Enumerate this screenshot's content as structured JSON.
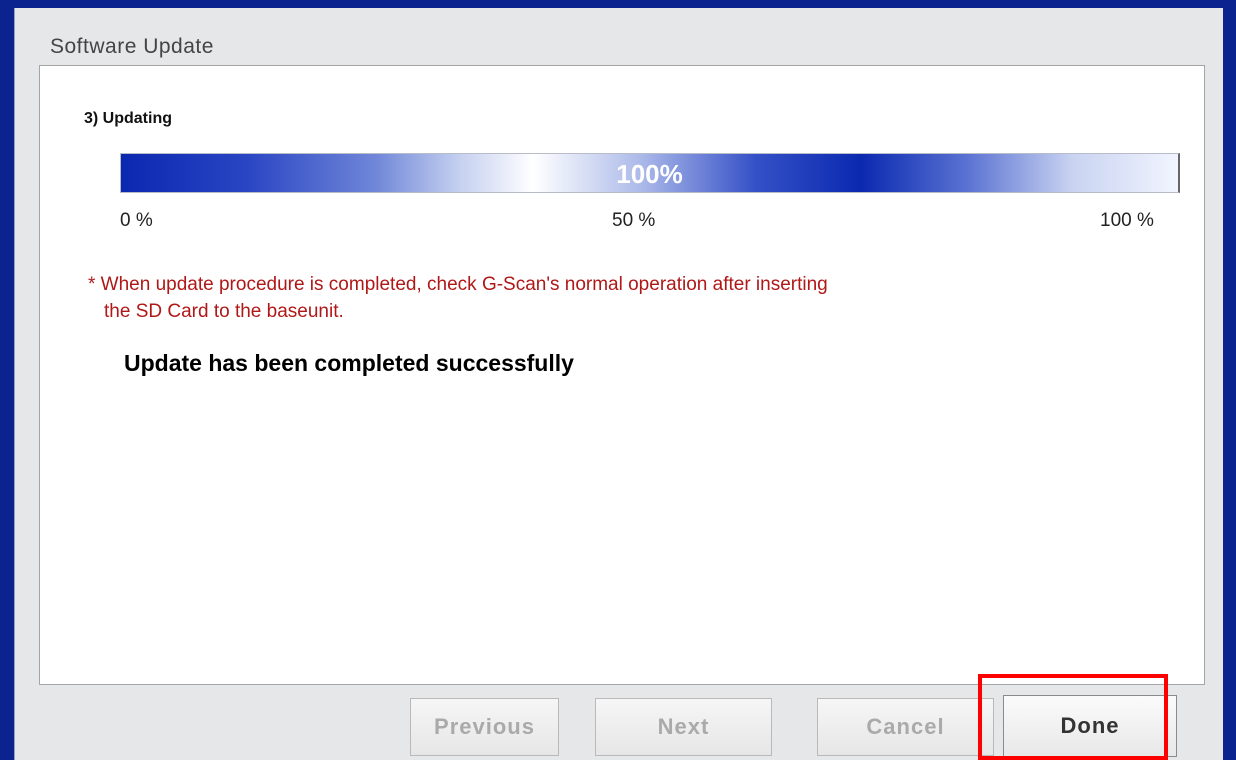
{
  "dialog": {
    "title": "Software Update"
  },
  "step": {
    "title": "3) Updating"
  },
  "progress": {
    "value": 1.0,
    "label": "100%",
    "scale": {
      "min_label": "0 %",
      "mid_label": "50 %",
      "max_label": "100 %"
    }
  },
  "note": {
    "line1": "* When update procedure is completed, check G-Scan's normal operation after inserting",
    "line2": "the SD Card to the baseunit."
  },
  "status": {
    "message": "Update has been completed successfully"
  },
  "buttons": {
    "previous": "Previous",
    "next": "Next",
    "cancel": "Cancel",
    "done": "Done"
  },
  "colors": {
    "background": "#0b238f",
    "note_text": "#b01818",
    "highlight": "#ff0000"
  }
}
